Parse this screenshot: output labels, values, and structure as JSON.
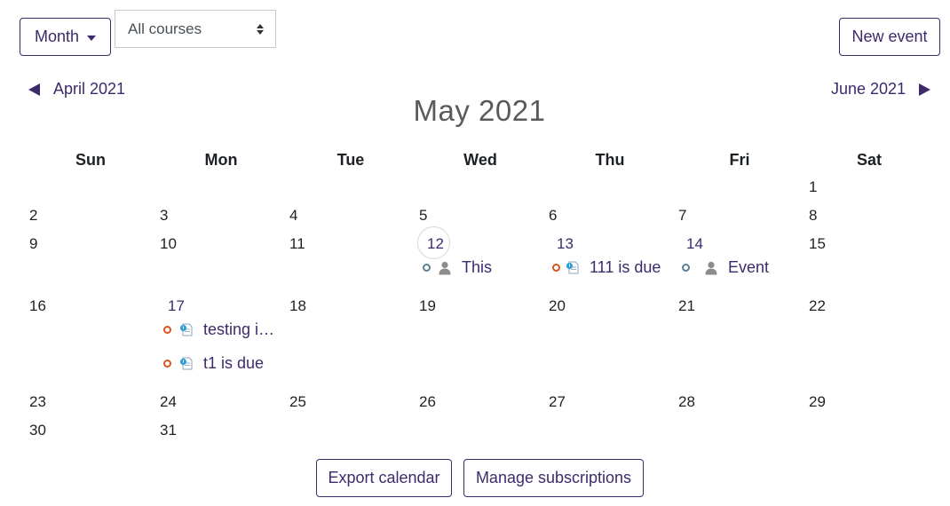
{
  "controls": {
    "view_label": "Month",
    "course_filter": "All courses",
    "new_event_label": "New event"
  },
  "nav": {
    "prev_label": "April 2021",
    "next_label": "June 2021",
    "current_title": "May 2021"
  },
  "weekdays": [
    "Sun",
    "Mon",
    "Tue",
    "Wed",
    "Thu",
    "Fri",
    "Sat"
  ],
  "days": {
    "d1": "1",
    "d2": "2",
    "d3": "3",
    "d4": "4",
    "d5": "5",
    "d6": "6",
    "d7": "7",
    "d8": "8",
    "d9": "9",
    "d10": "10",
    "d11": "11",
    "d12": "12",
    "d13": "13",
    "d14": "14",
    "d15": "15",
    "d16": "16",
    "d17": "17",
    "d18": "18",
    "d19": "19",
    "d20": "20",
    "d21": "21",
    "d22": "22",
    "d23": "23",
    "d24": "24",
    "d25": "25",
    "d26": "26",
    "d27": "27",
    "d28": "28",
    "d29": "29",
    "d30": "30",
    "d31": "31"
  },
  "events": {
    "e12": {
      "title": "This",
      "type": "user",
      "icon": "user-icon"
    },
    "e13": {
      "title": "111 is due",
      "type": "course",
      "icon": "assignment-icon"
    },
    "e14": {
      "title": "Event",
      "type": "user",
      "icon": "user-icon"
    },
    "e17a": {
      "title": "testing i…",
      "type": "course",
      "icon": "assignment-icon"
    },
    "e17b": {
      "title": "t1 is due",
      "type": "course",
      "icon": "assignment-icon"
    }
  },
  "footer": {
    "export_label": "Export calendar",
    "subscriptions_label": "Manage subscriptions"
  },
  "colors": {
    "brand": "#3d2a6b",
    "user_event": "#5a7f97",
    "course_event": "#d9531e"
  }
}
